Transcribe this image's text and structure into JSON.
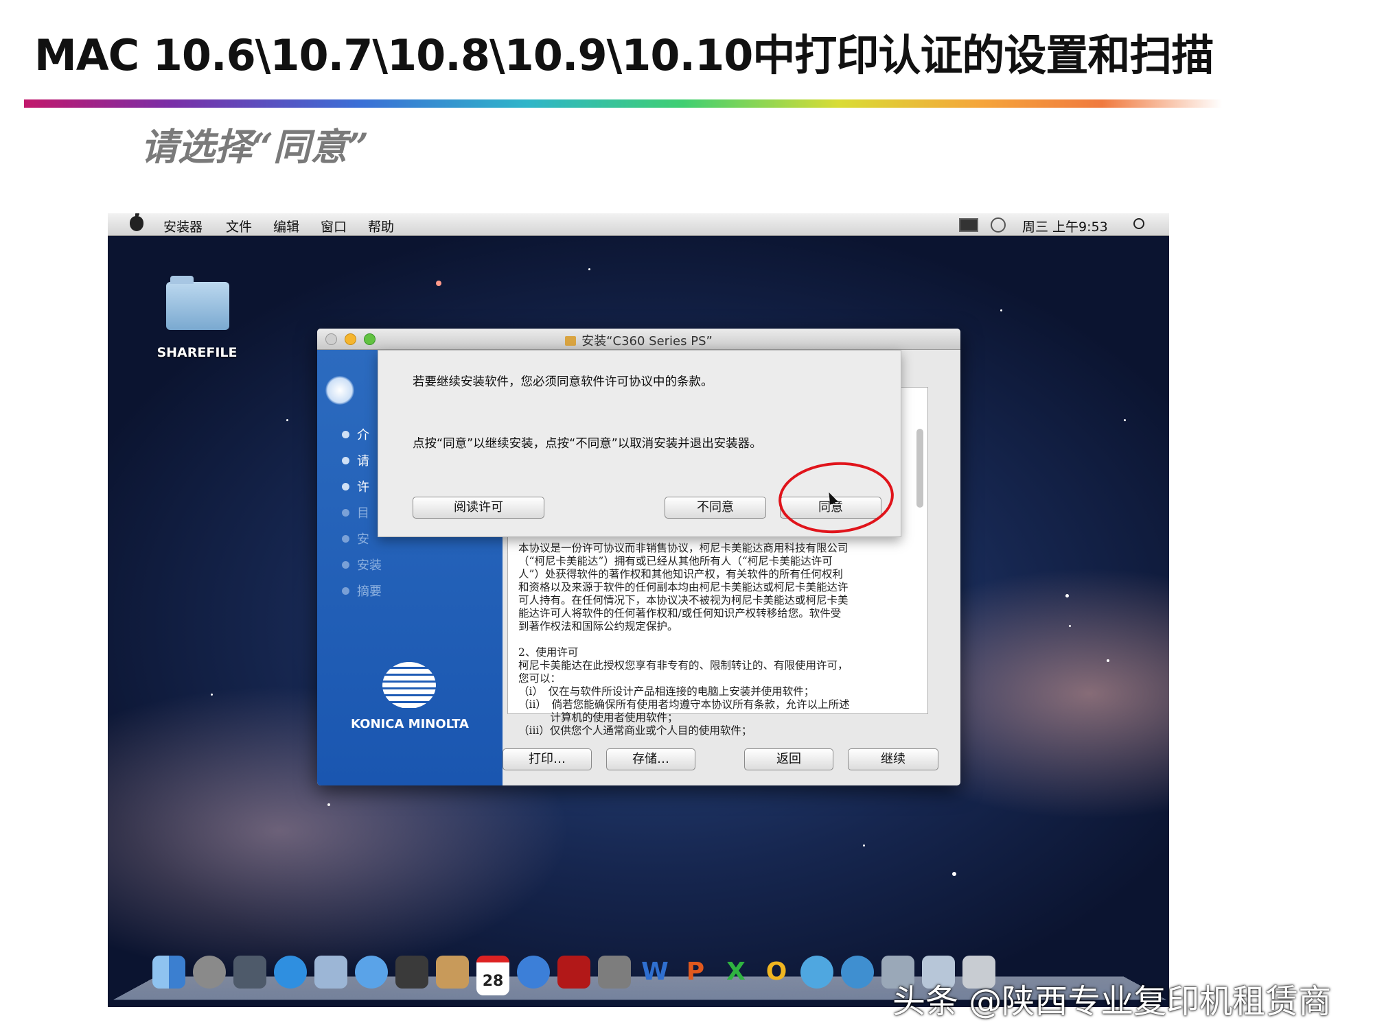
{
  "slide": {
    "title": "MAC 10.6\\10.7\\10.8\\10.9\\10.10中打印认证的设置和扫描",
    "subtitle": "请选择“同意”"
  },
  "menubar": {
    "apple_icon": "apple-icon",
    "items": [
      "安装器",
      "文件",
      "编辑",
      "窗口",
      "帮助"
    ],
    "status_icons": [
      "display-icon",
      "time-machine-icon",
      "search-icon"
    ],
    "clock": "周三 上午9:53"
  },
  "desktop": {
    "folder_label": "SHAREFILE"
  },
  "installer": {
    "window_title": "安装“C360 Series PS”",
    "steps": [
      "介",
      "请",
      "许",
      "目",
      "安",
      "安装",
      "摘要"
    ],
    "brand": "KONICA MINOLTA",
    "license_text": "本协议是一份许可协议而非销售协议，柯尼卡美能达商用科技有限公司\n（“柯尼卡美能达”）拥有或已经从其他所有人（“柯尼卡美能达许可\n人”）处获得软件的著作权和其他知识产权，有关软件的所有任何权利\n和资格以及来源于软件的任何副本均由柯尼卡美能达或柯尼卡美能达许\n可人持有。在任何情况下，本协议决不被视为柯尼卡美能达或柯尼卡美\n能达许可人将软件的任何著作权和/或任何知识产权转移给您。软件受\n到著作权法和国际公约规定保护。\n\n2、使用许可\n柯尼卡美能达在此授权您享有非专有的、限制转让的、有限使用许可，\n您可以：\n（i）　仅在与软件所设计产品相连接的电脑上安装并使用软件；\n（ii）　倘若您能确保所有使用者均遵守本协议所有条款，允许以上所述\n　　　计算机的使用者使用软件；\n（iii）仅供您个人通常商业或个人目的使用软件；",
    "buttons": {
      "print": "打印…",
      "save": "存储…",
      "back": "返回",
      "continue": "继续"
    }
  },
  "sheet": {
    "line1": "若要继续安装软件，您必须同意软件许可协议中的条款。",
    "line2": "点按“同意”以继续安装，点按“不同意”以取消安装并退出安装器。",
    "buttons": {
      "read": "阅读许可",
      "disagree": "不同意",
      "agree": "同意"
    }
  },
  "dock": {
    "icons": [
      "finder-icon",
      "launchpad-icon",
      "mission-control-icon",
      "app-store-icon",
      "preview-icon",
      "safari-icon",
      "facetime-icon",
      "contacts-icon",
      "calendar-icon",
      "itunes-icon",
      "photo-booth-icon",
      "system-preferences-icon",
      "word-icon",
      "powerpoint-icon",
      "excel-icon",
      "outlook-icon",
      "messenger-icon",
      "network-icon",
      "downloads-icon",
      "documents-icon",
      "trash-icon"
    ],
    "calendar_day": "28",
    "letters": {
      "word": "W",
      "powerpoint": "P",
      "excel": "X",
      "outlook": "O"
    }
  },
  "watermark": "头条 @陕西专业复印机租赁商",
  "colors": {
    "highlight_circle": "#e0141b",
    "installer_sidebar": "#1a56b0"
  }
}
